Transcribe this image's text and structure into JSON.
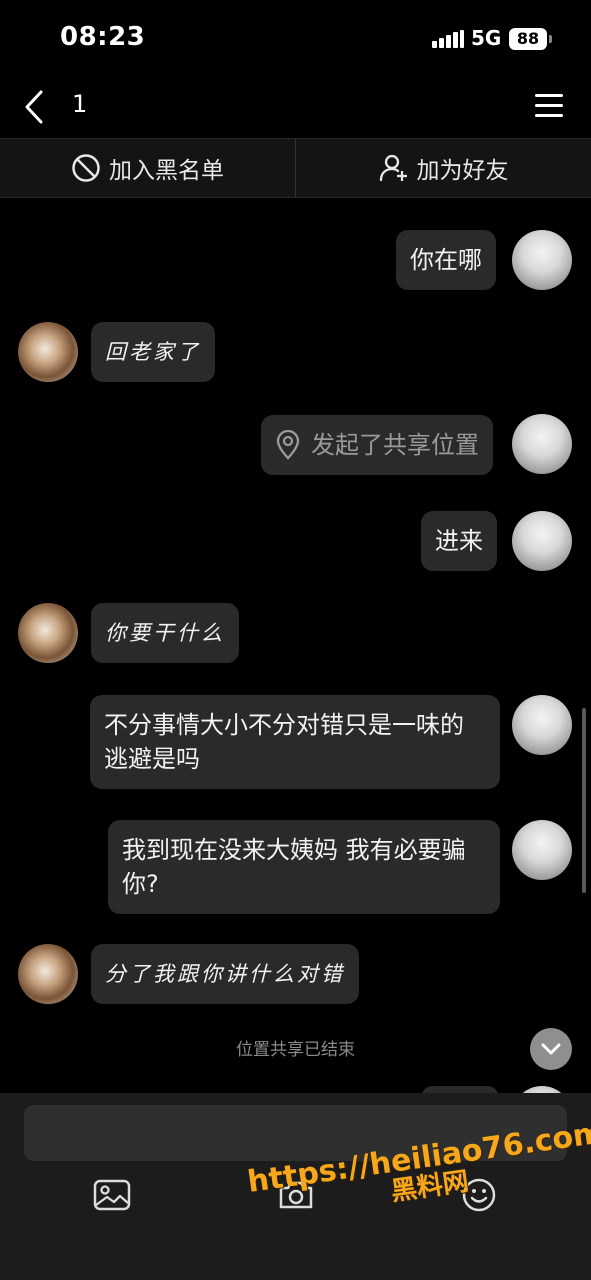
{
  "status_bar": {
    "time": "08:23",
    "network": "5G",
    "battery": "88"
  },
  "header": {
    "title": "1"
  },
  "actions": {
    "block_label": "加入黑名单",
    "add_friend_label": "加为好友"
  },
  "messages": [
    {
      "side": "right",
      "text": "你在哪"
    },
    {
      "side": "left",
      "text": "回老家了"
    },
    {
      "side": "right",
      "type": "location",
      "text": "发起了共享位置"
    },
    {
      "side": "right",
      "text": "进来"
    },
    {
      "side": "left",
      "text": "你要干什么"
    },
    {
      "side": "right",
      "text": "不分事情大小不分对错只是一味的逃避是吗"
    },
    {
      "side": "right",
      "text": "我到现在没来大姨妈 我有必要骗你?"
    },
    {
      "side": "left",
      "text": "分了我跟你讲什么对错"
    }
  ],
  "system_notice": "位置共享已结束",
  "input": {
    "placeholder": ""
  },
  "watermark": {
    "url": "https://heiliao76.com",
    "name": "黑料网"
  },
  "icons": {
    "back": "chevron-left-icon",
    "menu": "hamburger-icon",
    "block": "block-icon",
    "add_friend": "person-add-icon",
    "location": "location-pin-icon",
    "image": "image-icon",
    "camera": "camera-icon",
    "emoji": "emoji-icon",
    "scroll_down": "chevron-down-icon"
  }
}
